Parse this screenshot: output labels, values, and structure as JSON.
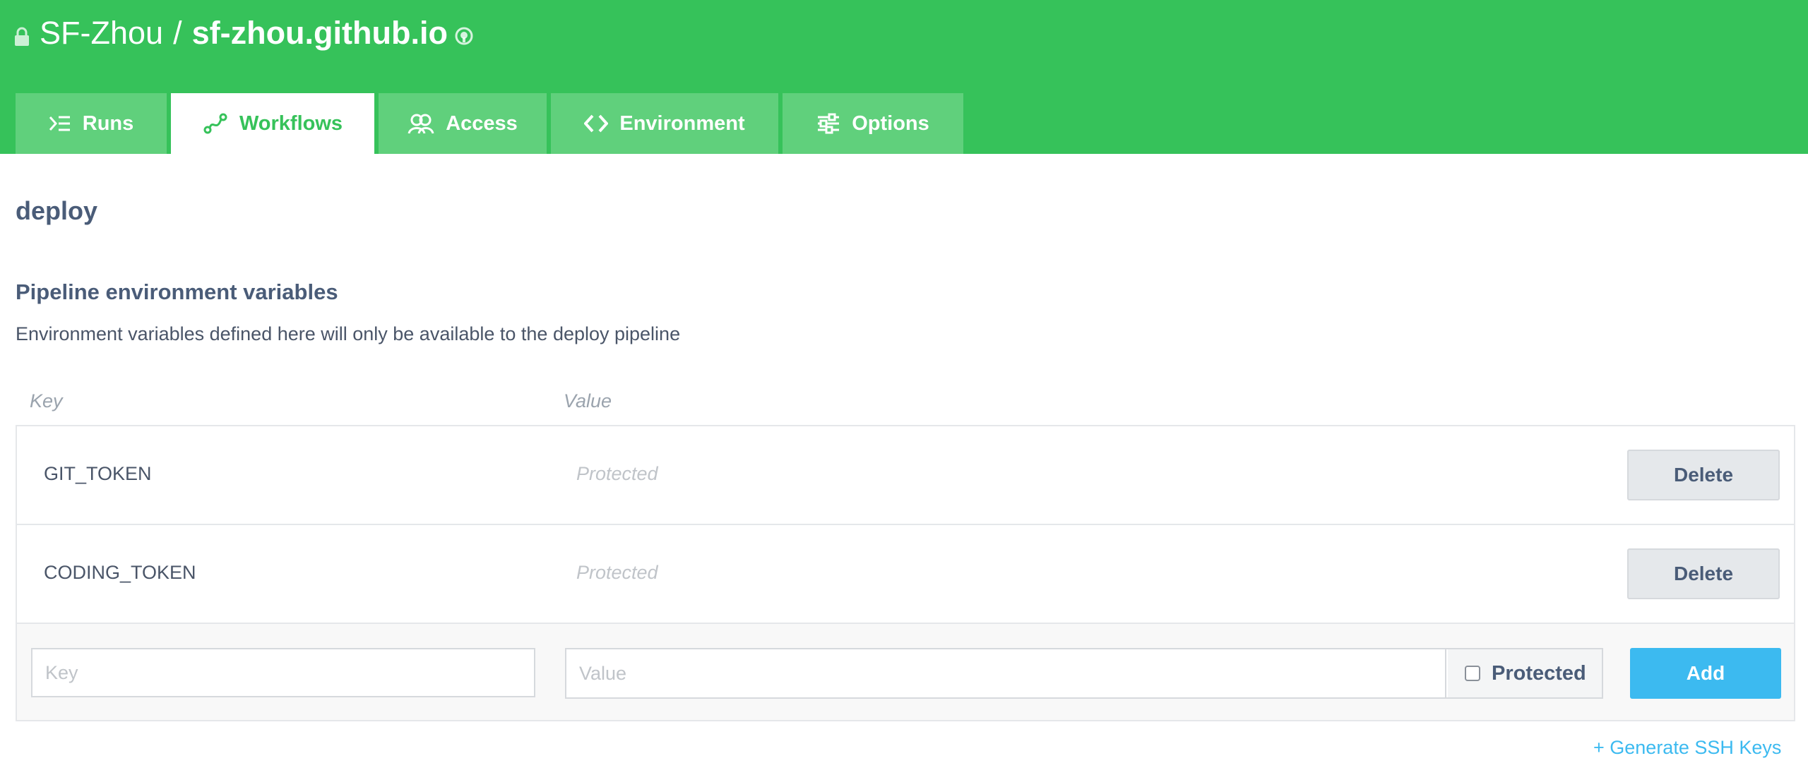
{
  "header": {
    "owner": "SF-Zhou",
    "separator": "/",
    "repo": "sf-zhou.github.io",
    "background": "#36c25a"
  },
  "tabs": [
    {
      "label": "Runs",
      "icon": "runs-icon",
      "active": false
    },
    {
      "label": "Workflows",
      "icon": "workflows-icon",
      "active": true
    },
    {
      "label": "Access",
      "icon": "access-icon",
      "active": false
    },
    {
      "label": "Environment",
      "icon": "environment-icon",
      "active": false
    },
    {
      "label": "Options",
      "icon": "options-icon",
      "active": false
    }
  ],
  "main": {
    "title": "deploy",
    "heading": "Pipeline environment variables",
    "description": "Environment variables defined here will only be available to the deploy pipeline",
    "columns": {
      "key": "Key",
      "value": "Value"
    },
    "rows": [
      {
        "key": "GIT_TOKEN",
        "value": "Protected",
        "action": "Delete"
      },
      {
        "key": "CODING_TOKEN",
        "value": "Protected",
        "action": "Delete"
      }
    ],
    "new_row": {
      "key_placeholder": "Key",
      "value_placeholder": "Value",
      "protected_label": "Protected",
      "protected_checked": false,
      "add_label": "Add"
    },
    "ssh_link": "+ Generate SSH Keys"
  },
  "colors": {
    "brand_green": "#36c25a",
    "tab_inactive": "#60d07c",
    "accent_blue": "#3cbaf0"
  }
}
